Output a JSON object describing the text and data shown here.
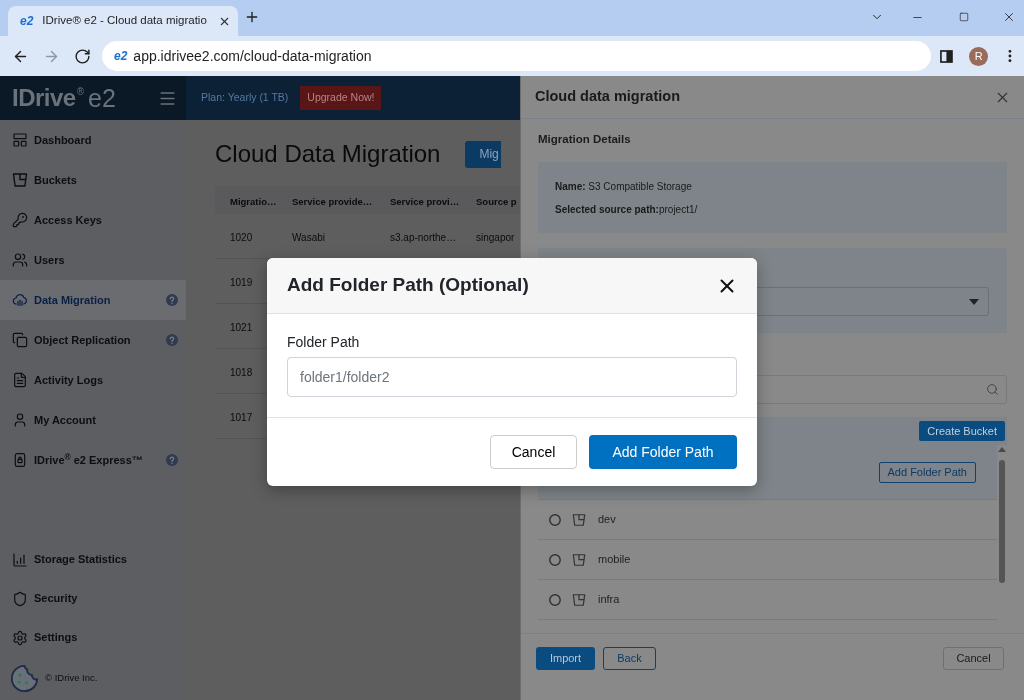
{
  "browser": {
    "tab": {
      "icon_text": "e2",
      "title": "IDrive® e2 - Cloud data migratio",
      "selected": true
    },
    "navigation": [
      {
        "kind": "back",
        "disabled": false
      },
      {
        "kind": "forward",
        "disabled": true
      },
      {
        "kind": "reload",
        "disabled": false
      }
    ],
    "address": {
      "icon_text": "e2",
      "url": "app.idrivee2.com/cloud-data-migration"
    },
    "profile_initial": "R"
  },
  "header": {
    "logo": {
      "name": "IDrive",
      "mark": "®",
      "product": "e2"
    },
    "plan": "Plan: Yearly (1 TB)",
    "upgrade_button": "Upgrade Now!"
  },
  "sidebar": {
    "items": [
      {
        "label": "Dashboard",
        "selected": false,
        "help": false
      },
      {
        "label": "Buckets",
        "selected": false,
        "help": false
      },
      {
        "label": "Access Keys",
        "selected": false,
        "help": false
      },
      {
        "label": "Users",
        "selected": false,
        "help": false
      },
      {
        "label": "Data Migration",
        "selected": true,
        "help": true
      },
      {
        "label": "Object Replication",
        "selected": false,
        "help": true
      },
      {
        "label": "Activity Logs",
        "selected": false,
        "help": false
      },
      {
        "label": "My Account",
        "selected": false,
        "help": false
      },
      {
        "label": "IDrive$^{®}$ e2 Express™",
        "selected": false,
        "help": true
      }
    ],
    "bottom_items": [
      {
        "label": "Storage Statistics",
        "selected": false
      },
      {
        "label": "Security",
        "selected": false
      },
      {
        "label": "Settings",
        "selected": false
      }
    ],
    "copyright": "© IDrive Inc."
  },
  "main": {
    "title": "Cloud Data Migration",
    "action_button": "Mig",
    "table": {
      "columns": [
        "Migratio…",
        "Service provide…",
        "Service provi…",
        "Source p"
      ],
      "rows": [
        [
          "1020",
          "Wasabi",
          "s3.ap-northe…",
          "singapor"
        ],
        [
          "1019"
        ],
        [
          "1021"
        ],
        [
          "1018"
        ],
        [
          "1017"
        ]
      ]
    }
  },
  "drawer": {
    "title": "Cloud data migration",
    "section_title": "Migration Details",
    "details": [
      "**Name:** S3 Compatible Storage",
      "**Selected source path:**project1/"
    ],
    "create_button": "Create Bucket",
    "buckets": [
      {
        "selected": true,
        "action": "Add Folder Path"
      },
      {
        "name": "dev",
        "selected": false
      },
      {
        "name": "mobile",
        "selected": false
      },
      {
        "name": "infra",
        "selected": false
      }
    ],
    "footer_buttons": [
      {
        "label": "Import",
        "kind": "primary"
      },
      {
        "label": "Back",
        "kind": "outline"
      },
      {
        "label": "Cancel",
        "kind": "secondary"
      }
    ]
  },
  "modal": {
    "title": "Add Folder Path (Optional)",
    "field": {
      "label": "Folder Path",
      "placeholder": "folder1/folder2"
    },
    "buttons": [
      {
        "label": "Cancel",
        "kind": "secondary"
      },
      {
        "label": "Add Folder Path",
        "kind": "primary"
      }
    ]
  }
}
